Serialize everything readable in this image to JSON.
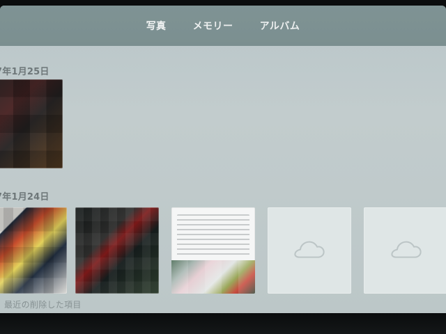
{
  "top_tabs": [
    {
      "label": "写真",
      "active": true
    },
    {
      "label": "メモリー",
      "active": false
    },
    {
      "label": "アルバム",
      "active": false
    }
  ],
  "sections": [
    {
      "date_label": "7年1月25日"
    },
    {
      "date_label": "7年1月24日"
    }
  ],
  "footer_label": "最近の削除した項目",
  "icons": {
    "cloud_placeholder": "cloud-icon"
  },
  "colors": {
    "topbar": "#7f9394",
    "background": "#c2cccd",
    "date_text": "#6e7779"
  }
}
